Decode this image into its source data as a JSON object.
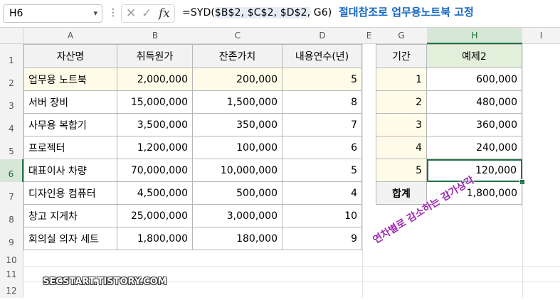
{
  "formula_bar": {
    "name_box": "H6",
    "formula_prefix": "=SYD(",
    "formula_selected": "$B$2, $C$2, $D$2,",
    "formula_suffix": " G6)",
    "cancel_glyph": "✕",
    "enter_glyph": "✓",
    "fx_glyph": "fx"
  },
  "annotations": {
    "title": "절대참조로 업무용노트북 고정",
    "diagonal": "연차별로 감소하는 감가상각",
    "watermark": "SECSTART.TISTORY.COM"
  },
  "columns": [
    "A",
    "B",
    "C",
    "D",
    "E",
    "G",
    "H",
    "I"
  ],
  "rows": [
    "1",
    "2",
    "3",
    "4",
    "5",
    "6",
    "7",
    "8",
    "9",
    "10",
    "11",
    "12"
  ],
  "table1": {
    "headers": [
      "자산명",
      "취득원가",
      "잔존가치",
      "내용연수(년)"
    ],
    "rows": [
      [
        "업무용 노트북",
        "2,000,000",
        "200,000",
        "5"
      ],
      [
        "서버 장비",
        "15,000,000",
        "1,500,000",
        "8"
      ],
      [
        "사무용 복합기",
        "3,500,000",
        "350,000",
        "7"
      ],
      [
        "프로젝터",
        "1,200,000",
        "100,000",
        "6"
      ],
      [
        "대표이사 차량",
        "70,000,000",
        "10,000,000",
        "5"
      ],
      [
        "디자인용 컴퓨터",
        "4,500,000",
        "500,000",
        "4"
      ],
      [
        "창고 지게차",
        "25,000,000",
        "3,000,000",
        "10"
      ],
      [
        "회의실 의자 세트",
        "1,800,000",
        "180,000",
        "9"
      ]
    ]
  },
  "table2": {
    "headers": [
      "기간",
      "예제2"
    ],
    "rows": [
      [
        "1",
        "600,000"
      ],
      [
        "2",
        "480,000"
      ],
      [
        "3",
        "360,000"
      ],
      [
        "4",
        "240,000"
      ],
      [
        "5",
        "120,000"
      ]
    ],
    "total_label": "합계",
    "total_value": "1,800,000"
  },
  "colors": {
    "selection": "#217346",
    "title_text": "#1565c0",
    "diagonal_text": "#9c27b0",
    "yellow_fill": "#fefce8",
    "green_fill": "#e2efda"
  }
}
